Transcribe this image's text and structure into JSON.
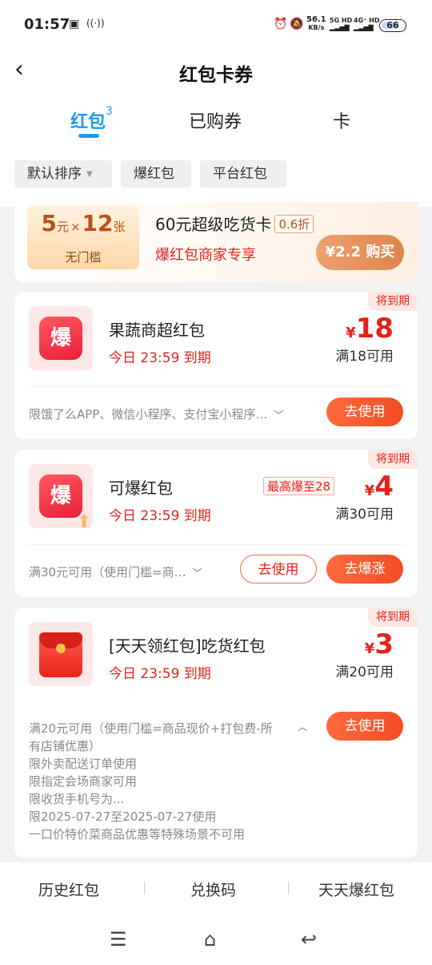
{
  "status_bar": {
    "time": "01:57",
    "net_speed_value": "56.1",
    "net_speed_unit": "KB/s",
    "sig1": "5G HD",
    "sig2": "4G⁺ HD",
    "battery": "66"
  },
  "header": {
    "title": "红包卡券",
    "tabs": [
      {
        "label": "红包",
        "badge": "3"
      },
      {
        "label": "已购券"
      },
      {
        "label": "卡"
      }
    ],
    "filters": [
      "默认排序",
      "爆红包",
      "平台红包"
    ]
  },
  "promo_card": {
    "ticket_amount_1": "5",
    "ticket_unit_1": "元",
    "ticket_times": "×",
    "ticket_amount_2": "12",
    "ticket_unit_2": "张",
    "ticket_sub": "无门槛",
    "title": "60元超级吃货卡",
    "discount": "0.6折",
    "subtitle": "爆红包商家专享",
    "buy_label": "¥2.2 购买"
  },
  "coupons": [
    {
      "tag": "将到期",
      "name": "果蔬商超红包",
      "expiry": "今日 23:59 到期",
      "yen": "¥",
      "amount": "18",
      "condition": "满18可用",
      "rule": "限饿了么APP、微信小程序、支付宝小程序…",
      "use_label": "去使用"
    },
    {
      "tag": "将到期",
      "name": "可爆红包",
      "expiry": "今日 23:59 到期",
      "boom_badge": "最高爆至28",
      "yen": "¥",
      "amount": "4",
      "condition": "满30可用",
      "rule": "满30元可用（使用门槛=商…",
      "use_label": "去使用",
      "boom_label": "去爆涨"
    },
    {
      "tag": "将到期",
      "name": "[天天领红包]吃货红包",
      "expiry": "今日 23:59 到期",
      "yen": "¥",
      "amount": "3",
      "condition": "满20可用",
      "rules": [
        "满20元可用（使用门槛=商品现价+打包费-所",
        "有店铺优惠）",
        "限外卖配送订单使用",
        "限指定会场商家可用",
        "限收货手机号为...",
        "限2025-07-27至2025-07-27使用",
        "一口价特价菜商品优惠等特殊场景不可用"
      ],
      "use_label": "去使用"
    }
  ],
  "bottom_bar": {
    "items": [
      "历史红包",
      "兑换码",
      "天天爆红包"
    ]
  }
}
